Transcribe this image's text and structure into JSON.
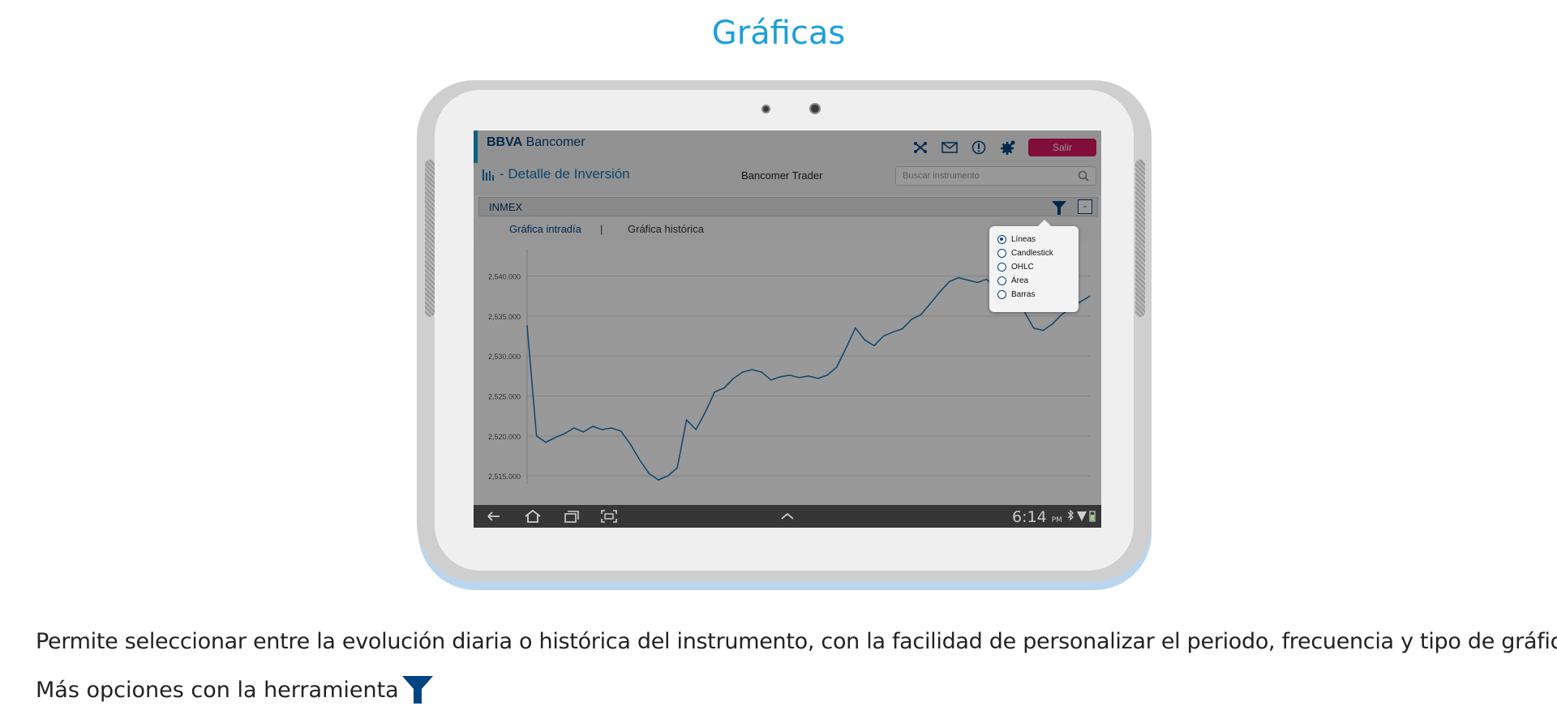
{
  "page_title": "Gráficas",
  "app": {
    "brand_bold": "BBVA",
    "brand_rest": " Bancomer",
    "exit_label": "Salir",
    "detail_title": "- Detalle de Inversión",
    "trader": "Bancomer Trader",
    "search_placeholder": "Buscar instrumento",
    "header_icons": [
      "network-icon",
      "mail-icon",
      "info-icon",
      "settings-icon"
    ]
  },
  "panel": {
    "instrument": "INMEX",
    "minimize": "-",
    "tabs": {
      "intraday": "Gráfica intradía",
      "separator": "|",
      "historic": "Gráfica histórica"
    }
  },
  "chart_type_menu": {
    "options": [
      "Líneas",
      "Candlestick",
      "OHLC",
      "Área",
      "Barras"
    ],
    "selected": "Líneas"
  },
  "chart_data": {
    "type": "line",
    "y_ticks": [
      "2,540.000",
      "2,535.000",
      "2,530.000",
      "2,525.000",
      "2,520.000",
      "2,515.000"
    ],
    "ylim": [
      2514,
      2543
    ],
    "line_color": "#1773b6",
    "x": [
      0,
      1,
      2,
      3,
      4,
      5,
      6,
      7,
      8,
      9,
      10,
      11,
      12,
      13,
      14,
      15,
      16,
      17,
      18,
      19,
      20,
      21,
      22,
      23,
      24,
      25,
      26,
      27,
      28,
      29,
      30,
      31,
      32,
      33,
      34,
      35,
      36,
      37,
      38,
      39,
      40,
      41,
      42,
      43,
      44,
      45,
      46,
      47,
      48,
      49,
      50,
      51,
      52,
      53,
      54,
      55,
      56,
      57,
      58,
      59,
      60
    ],
    "values": [
      2533.8,
      2520.0,
      2519.2,
      2519.8,
      2520.3,
      2521.0,
      2520.5,
      2521.2,
      2520.8,
      2521.0,
      2520.6,
      2519.0,
      2517.0,
      2515.3,
      2514.5,
      2515.0,
      2516.0,
      2522.0,
      2520.8,
      2523.0,
      2525.5,
      2526.0,
      2527.2,
      2528.0,
      2528.3,
      2528.0,
      2527.0,
      2527.4,
      2527.6,
      2527.3,
      2527.5,
      2527.2,
      2527.6,
      2528.6,
      2531.0,
      2533.5,
      2532.0,
      2531.3,
      2532.5,
      2533.0,
      2533.4,
      2534.6,
      2535.2,
      2536.6,
      2538.0,
      2539.3,
      2539.8,
      2539.5,
      2539.2,
      2539.6,
      2538.4,
      2539.0,
      2538.0,
      2535.6,
      2533.5,
      2533.2,
      2534.0,
      2535.2,
      2536.0,
      2536.8,
      2537.5
    ]
  },
  "android_nav": {
    "time": "6:14",
    "ampm": "PM"
  },
  "description": "Permite seleccionar entre  la evolución diaria o histórica del instrumento, con la facilidad de personalizar el periodo, frecuencia y tipo de gráfico.",
  "more_options": "Más opciones con la herramienta",
  "colors": {
    "accent": "#1ba0d8",
    "brand": "#004481",
    "exit": "#d8175f"
  }
}
